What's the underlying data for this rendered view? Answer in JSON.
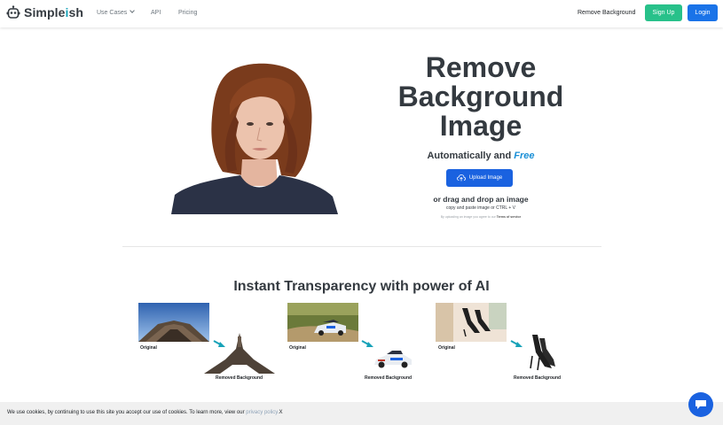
{
  "nav": {
    "brand": "Simpleish",
    "brand_prefix": "Simple",
    "brand_i": "i",
    "brand_suffix": "sh",
    "use_cases": "Use Cases",
    "api": "API",
    "pricing": "Pricing",
    "remove_background": "Remove Background",
    "signup": "Sign Up",
    "login": "Login"
  },
  "hero": {
    "title_line1": "Remove",
    "title_line2": "Background",
    "title_line3": "Image",
    "subtitle_prefix": "Automatically and ",
    "subtitle_free": "Free",
    "upload_button": "Upload Image",
    "drag_text": "or drag and drop an image",
    "paste_text": "copy and paste image or CTRL + V",
    "terms_prefix": "By uploading an image you agree to our ",
    "terms_link": "Terms of service"
  },
  "section": {
    "title": "Instant Transparency with power of AI",
    "examples": [
      {
        "original_label": "Original",
        "result_label": "Removed Background"
      },
      {
        "original_label": "Original",
        "result_label": "Removed Background"
      },
      {
        "original_label": "Original",
        "result_label": "Removed Background"
      }
    ]
  },
  "cookie": {
    "text": "We use cookies, by continuing to use this site you accept our use of cookies. To learn more, view our ",
    "link": "privacy policy.",
    "close": "X"
  },
  "colors": {
    "accent_blue": "#1a62e0",
    "signup_green": "#28c18a",
    "arrow_teal": "#17a2b8"
  },
  "icons": {
    "logo": "robot-icon",
    "upload": "cloud-upload-icon",
    "chat": "chat-bubble-icon",
    "dropdown": "chevron-down-icon"
  }
}
